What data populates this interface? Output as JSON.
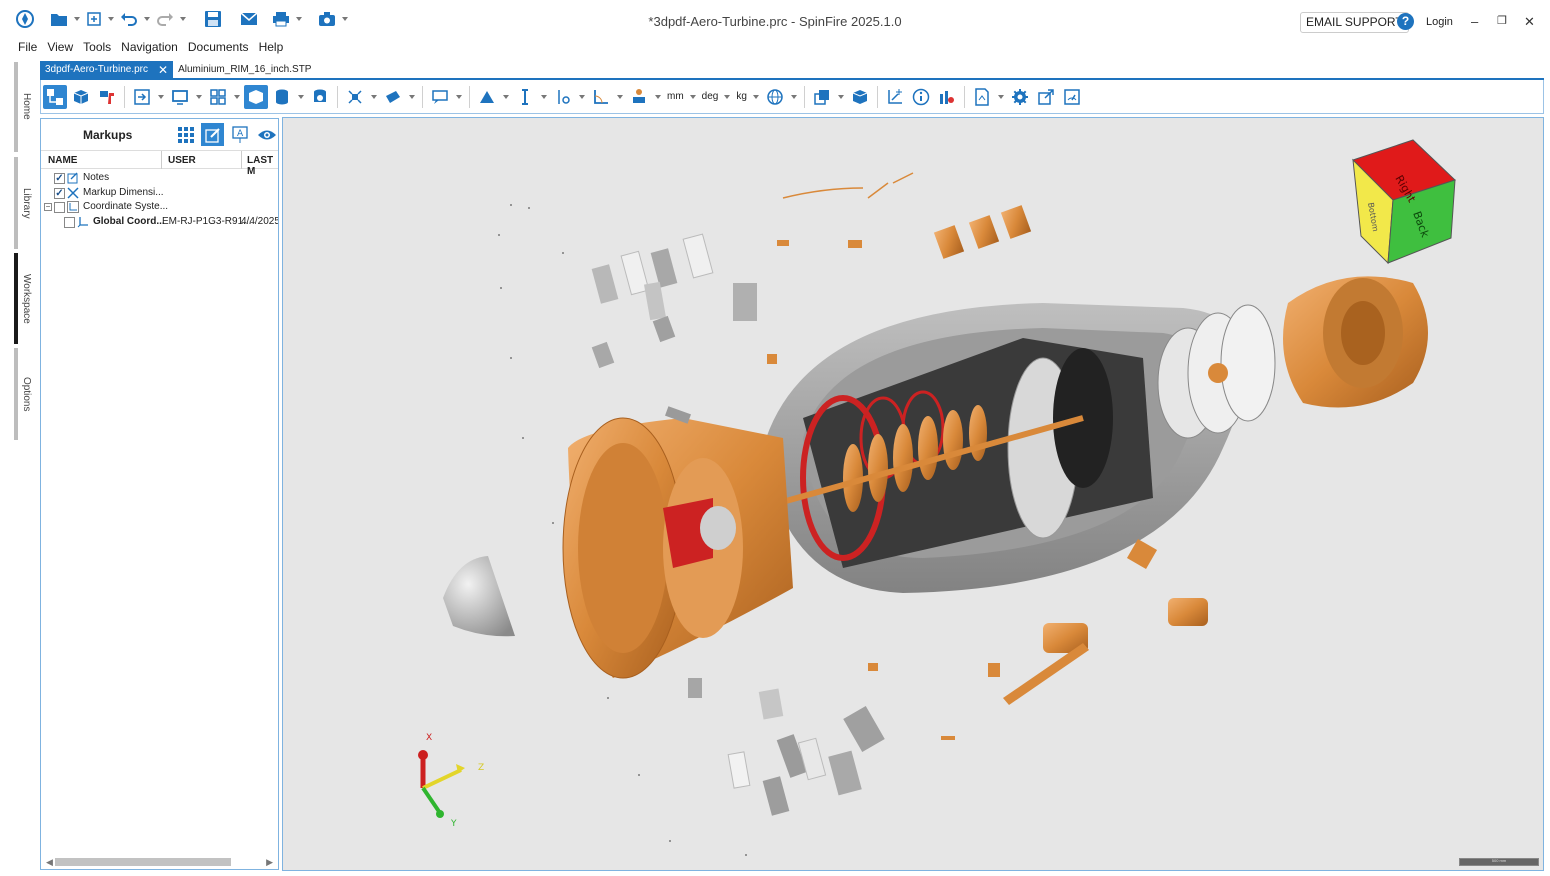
{
  "window": {
    "title": "*3dpdf-Aero-Turbine.prc - SpinFire 2025.1.0",
    "email_support": "EMAIL SUPPORT",
    "login": "Login"
  },
  "menu": [
    "File",
    "View",
    "Tools",
    "Navigation",
    "Documents",
    "Help"
  ],
  "left_rail": [
    "Home",
    "Library",
    "Workspace",
    "Options"
  ],
  "left_rail_active": "Workspace",
  "tabs": [
    {
      "label": "3dpdf-Aero-Turbine.prc",
      "active": true
    },
    {
      "label": "Aluminium_RIM_16_inch.STP",
      "active": false
    }
  ],
  "toolbar": {
    "units_length": "mm",
    "units_angle": "deg",
    "units_mass": "kg"
  },
  "markups_panel": {
    "title": "Markups",
    "columns": [
      "NAME",
      "USER",
      "LAST M"
    ],
    "rows": [
      {
        "name": "Notes",
        "checked": true,
        "icon": "note-icon"
      },
      {
        "name": "Markup Dimensi...",
        "checked": true,
        "icon": "dimension-icon"
      },
      {
        "name": "Coordinate Syste...",
        "checked": false,
        "icon": "coordinate-system-icon",
        "expander": "−"
      },
      {
        "name": "Global Coord...",
        "user": "EM-RJ-P1G3-R91...",
        "last": "4/4/2025",
        "checked": false,
        "icon": "axis-icon"
      }
    ]
  },
  "viewport": {
    "view_cube": {
      "top": "Right",
      "left": "Bottom",
      "front": "Back"
    },
    "triad": {
      "x": "X",
      "y": "Y",
      "z": "Z"
    },
    "scale_label": "500 mm"
  },
  "colors": {
    "accent": "#1e73be",
    "copper": "#d9893a",
    "viewport_bg": "#e6e6e6"
  }
}
